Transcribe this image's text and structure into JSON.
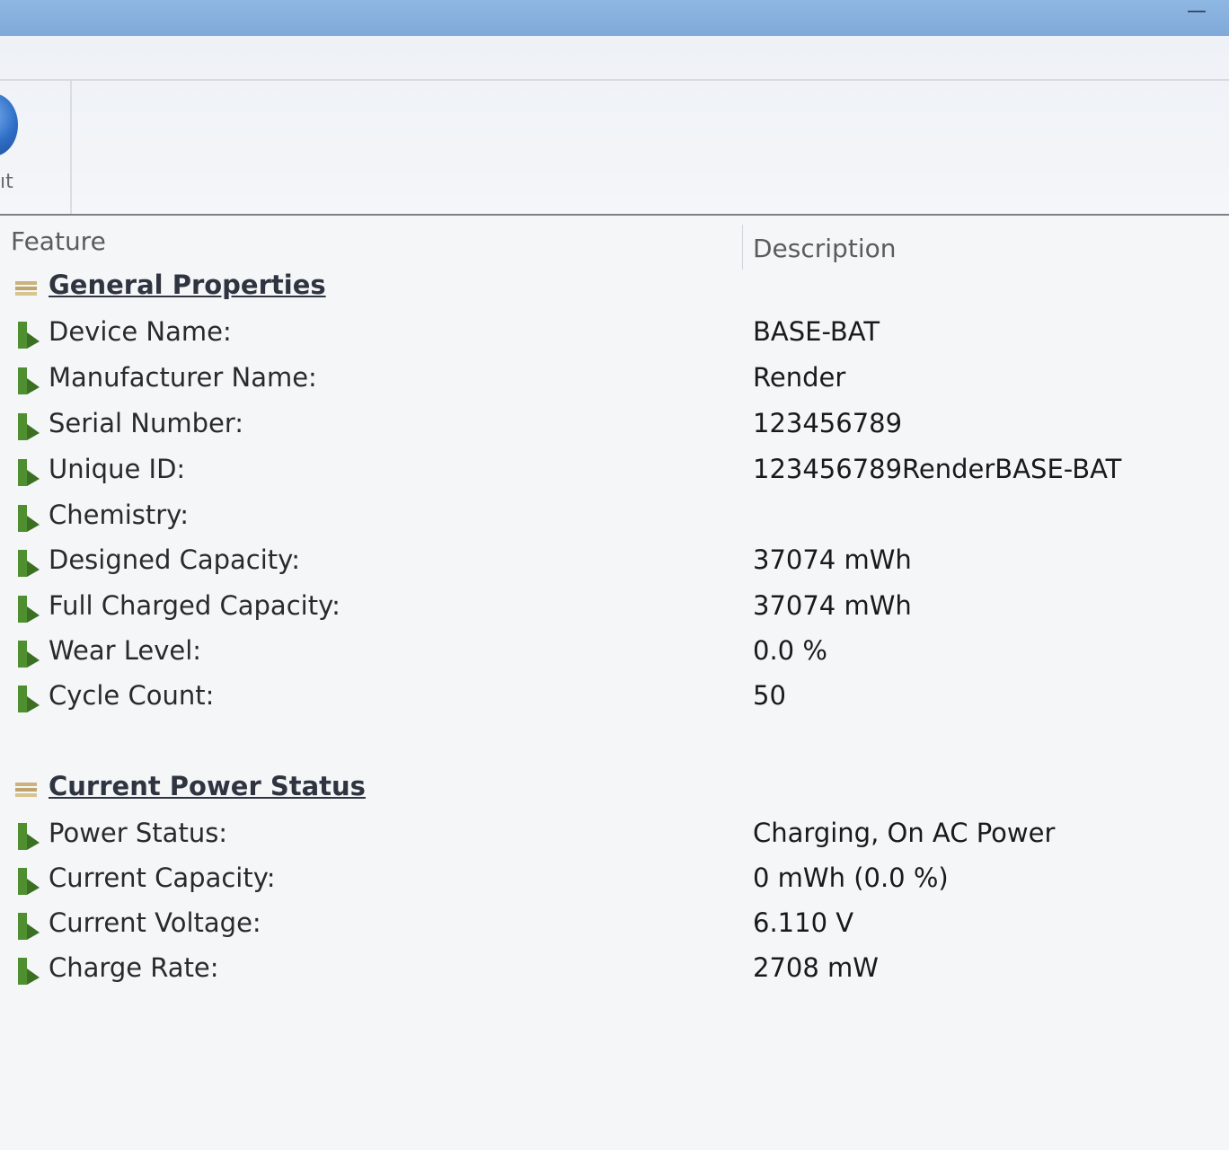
{
  "window": {
    "minimize_glyph": "—"
  },
  "toolbar": {
    "partial_label": "ıt"
  },
  "list": {
    "headers": {
      "feature": "Feature",
      "description": "Description"
    },
    "sections": [
      {
        "title": "General Properties",
        "rows": [
          {
            "label": "Device Name:",
            "value": "BASE-BAT"
          },
          {
            "label": "Manufacturer Name:",
            "value": "Render"
          },
          {
            "label": "Serial Number:",
            "value": "123456789"
          },
          {
            "label": "Unique ID:",
            "value": "123456789RenderBASE-BAT"
          },
          {
            "label": "Chemistry:",
            "value": ""
          },
          {
            "label": "Designed Capacity:",
            "value": "37074 mWh"
          },
          {
            "label": "Full Charged Capacity:",
            "value": "37074 mWh"
          },
          {
            "label": "Wear Level:",
            "value": "0.0 %"
          },
          {
            "label": "Cycle Count:",
            "value": "50"
          }
        ]
      },
      {
        "title": "Current Power Status",
        "rows": [
          {
            "label": "Power Status:",
            "value": "Charging, On AC Power"
          },
          {
            "label": "Current Capacity:",
            "value": "0 mWh (0.0 %)"
          },
          {
            "label": "Current Voltage:",
            "value": "6.110 V"
          },
          {
            "label": "Charge Rate:",
            "value": "2708 mW"
          }
        ]
      }
    ]
  },
  "icons": {
    "section": "section-stack-icon",
    "row": "battery-item-icon"
  },
  "colors": {
    "titlebar": "#7fa9d9",
    "row_icon_green": "#4f8f2f",
    "section_icon": "#c8b27a"
  }
}
